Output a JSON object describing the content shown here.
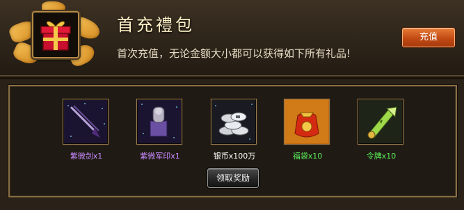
{
  "header": {
    "title": "首充禮包",
    "subtitle": "首次充值，无论金额大小都可以获得如下所有礼品!",
    "recharge_label": "充值"
  },
  "rewards": [
    {
      "icon": "purple-sword-icon",
      "label": "紫微剑x1",
      "color": "#c98bff"
    },
    {
      "icon": "purple-seal-icon",
      "label": "紫微军印x1",
      "color": "#c98bff"
    },
    {
      "icon": "silver-coins-icon",
      "label": "银币x100万",
      "color": "#ffffff"
    },
    {
      "icon": "lucky-bag-icon",
      "label": "福袋x10",
      "color": "#5cf05c"
    },
    {
      "icon": "command-token-icon",
      "label": "令牌x10",
      "color": "#5cf05c"
    }
  ],
  "claim_label": "领取奖励",
  "colors": {
    "recharge_button": "#c14a14",
    "title_text": "#fff1c8",
    "panel_border": "#8a6f45"
  }
}
